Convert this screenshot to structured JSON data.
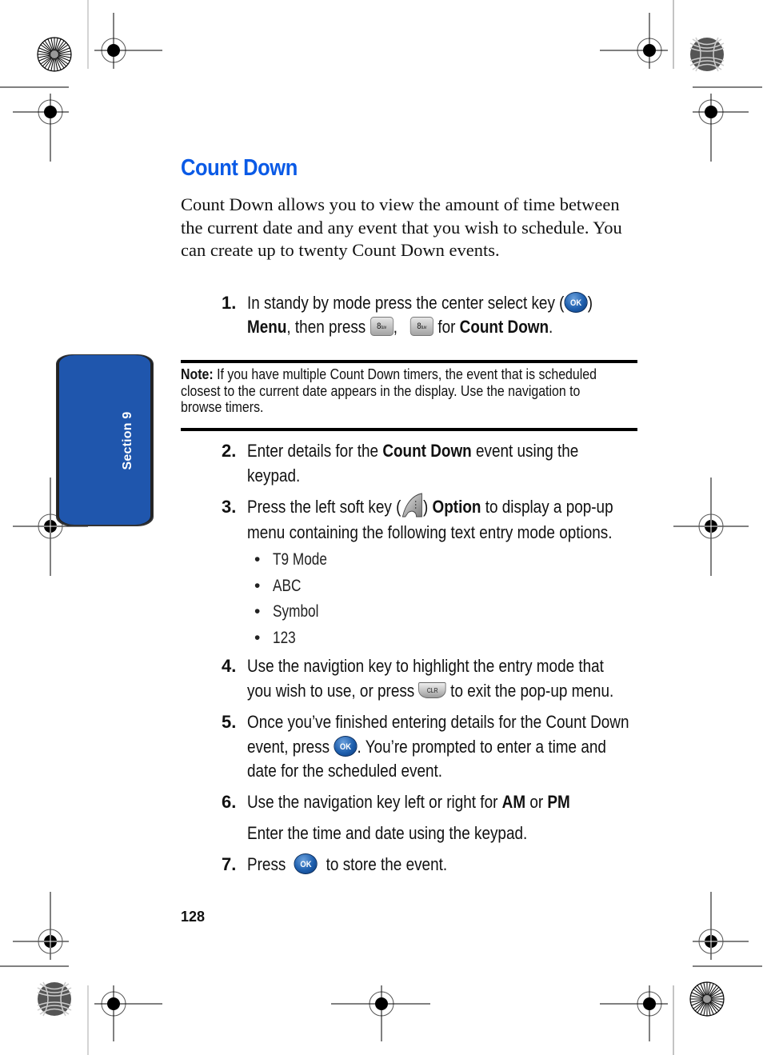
{
  "section_tab": {
    "label": "Section 9",
    "color": "#1f56ad"
  },
  "title": "Count Down",
  "title_color": "#0a5ae6",
  "intro": "Count Down allows you to view the amount of time between the current date and any event that you wish to schedule. You can create up to twenty Count Down events.",
  "step1": {
    "num": "1.",
    "line1_a": "In standy by mode press the center select key (",
    "line1_b": ")",
    "menu": "Menu",
    "line2_a": ", then press ",
    "line2_b": ",",
    "line2_c": " for ",
    "count_down": "Count Down",
    "line2_d": "."
  },
  "keys": {
    "ok": "OK",
    "eight": "8",
    "eight_sub": "tuv",
    "clr": "CLR"
  },
  "note": {
    "label": "Note:",
    "line1": " If you have multiple Count Down timers, the event that is scheduled",
    "line2": "closest to the current date appears in the display. Use the navigation to",
    "line3": "browse timers."
  },
  "step2": {
    "num": "2.",
    "a": "Enter details for the ",
    "bold": "Count Down",
    "b": " event using the",
    "line2": "keypad."
  },
  "step3": {
    "num": "3.",
    "a": "Press the left soft key (",
    "b": ") ",
    "bold": "Option",
    "c": " to display a pop-up",
    "line2": "menu containing the following text entry mode options."
  },
  "bullets": [
    "T9 Mode",
    "ABC",
    "Symbol",
    "123"
  ],
  "bullet_glyph": "•",
  "step4": {
    "num": "4.",
    "line1": "Use the navigtion key to highlight the entry mode that",
    "line2_a": "you wish to use, or press ",
    "line2_b": " to exit the pop-up menu."
  },
  "step5": {
    "num": "5.",
    "line1": "Once you’ve finished entering details for the Count Down",
    "line2_a": "event, press ",
    "line2_b": ". You’re prompted to enter a time and",
    "line3": "date for the scheduled event."
  },
  "step6": {
    "num": "6.",
    "a": "Use the navigation key left or right for ",
    "am": "AM",
    "or": " or ",
    "pm": "PM",
    "line2": "Enter the time and date using the keypad."
  },
  "step7": {
    "num": "7.",
    "a": "Press ",
    "b": " to store the event."
  },
  "page_number": "128"
}
